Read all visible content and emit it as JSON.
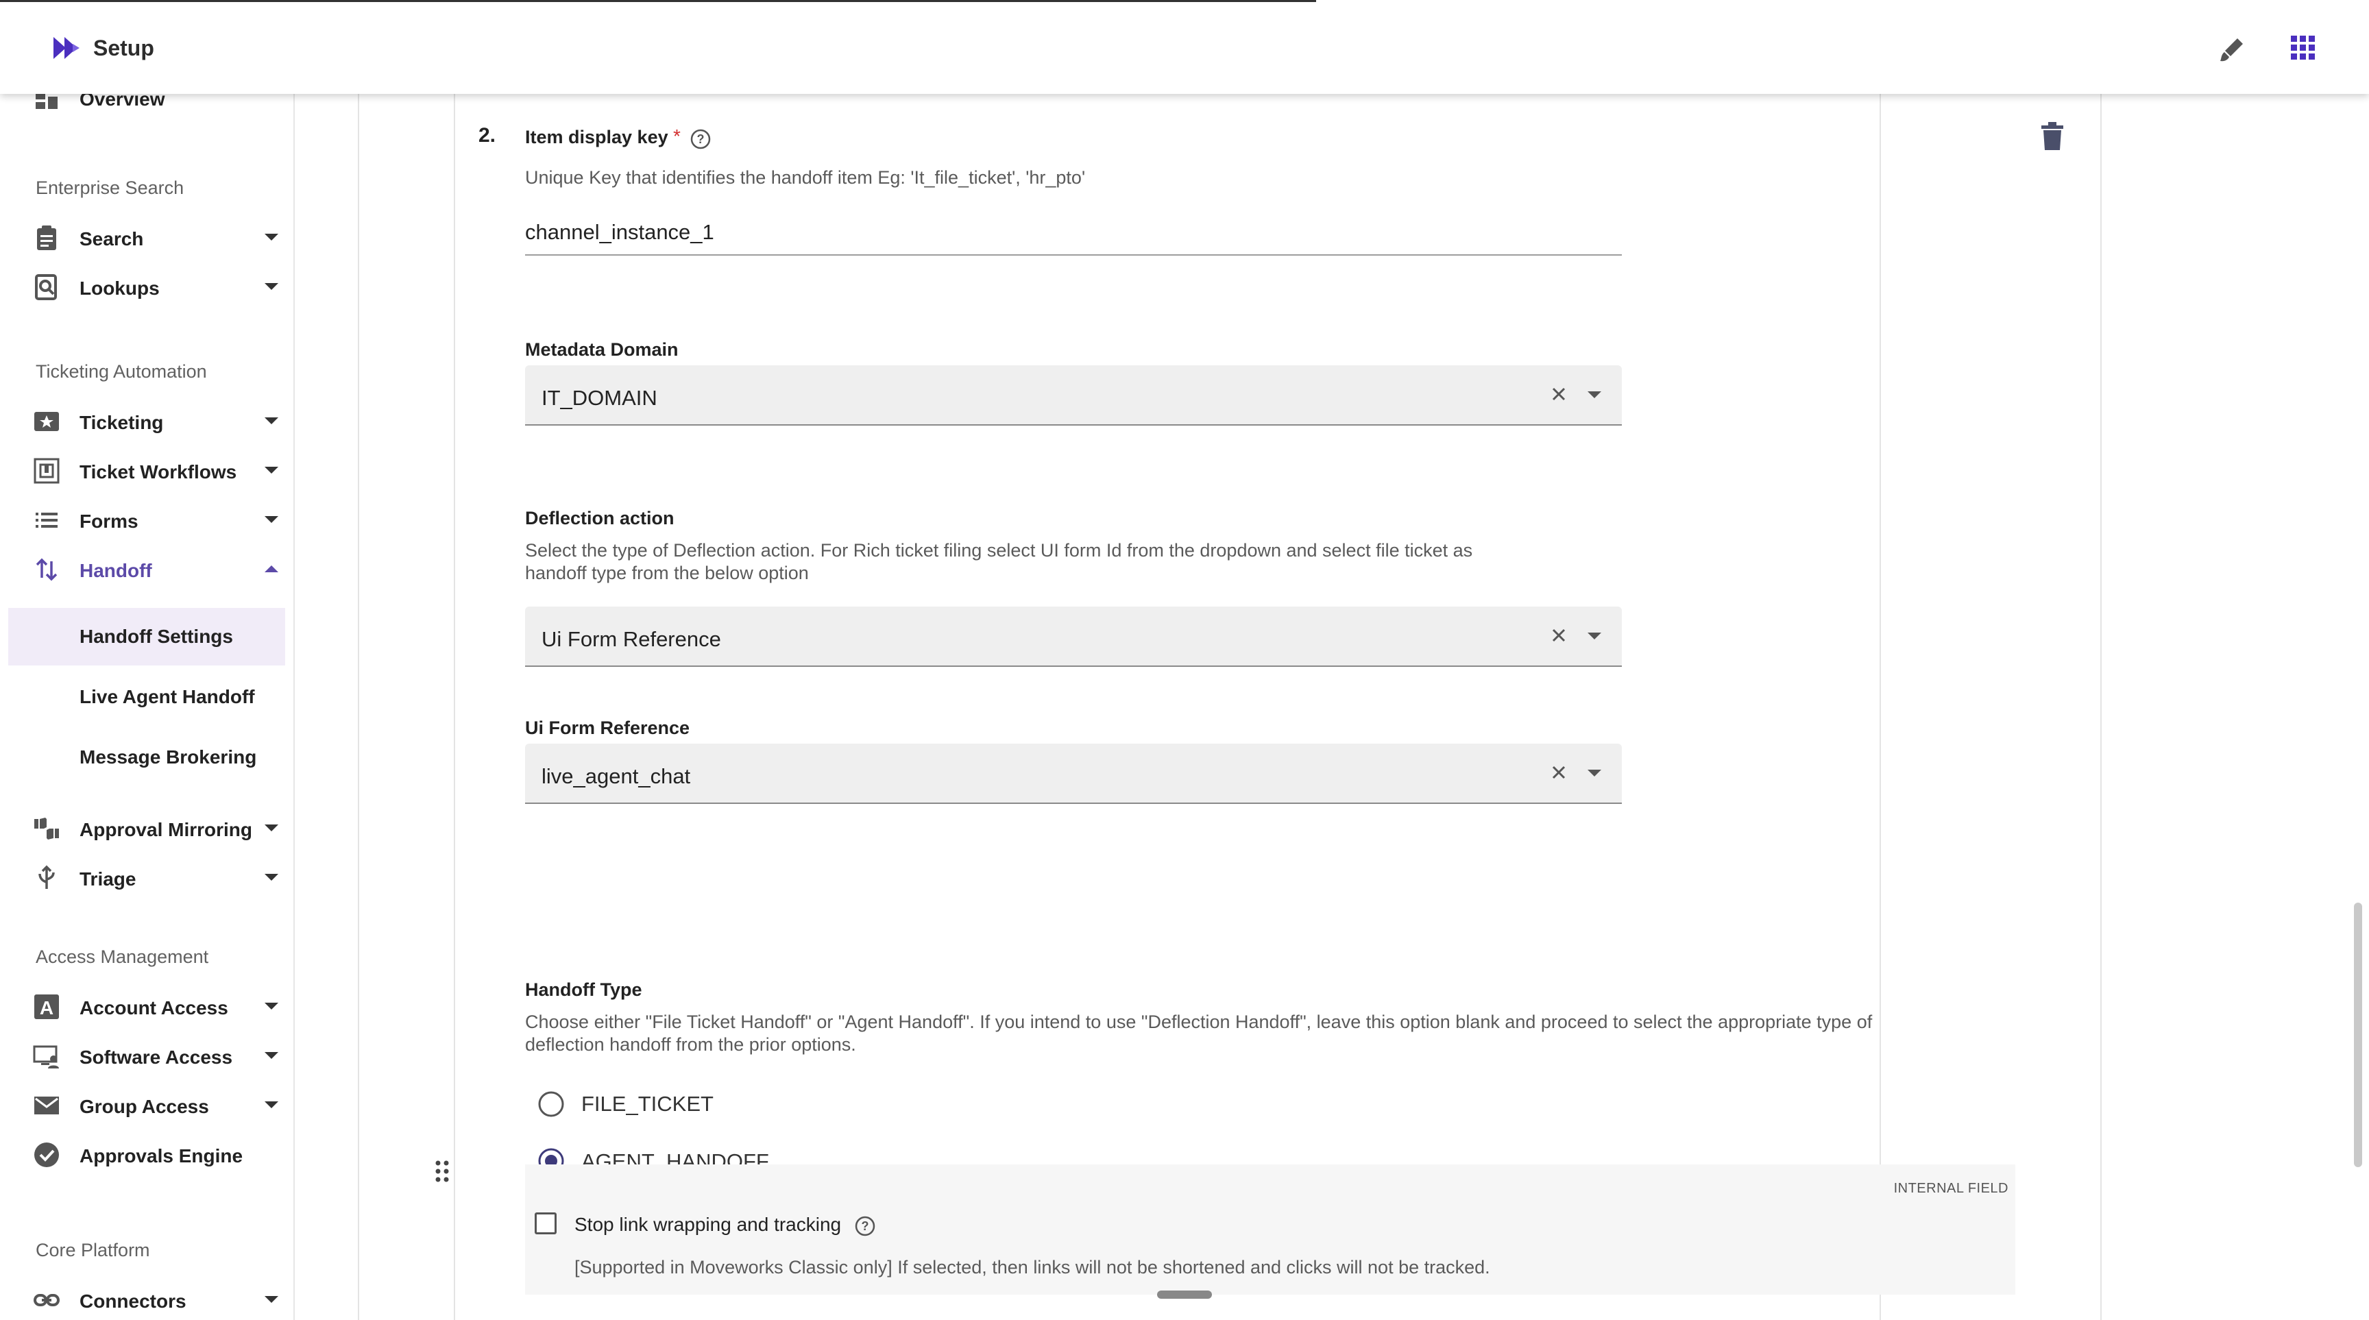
{
  "header": {
    "title": "Setup"
  },
  "sidebar": {
    "overview": "Overview",
    "sections": [
      {
        "label": "Enterprise Search"
      },
      {
        "label": "Ticketing Automation"
      },
      {
        "label": "Access Management"
      },
      {
        "label": "Core Platform"
      }
    ],
    "items": {
      "search": "Search",
      "lookups": "Lookups",
      "ticketing": "Ticketing",
      "ticket_workflows": "Ticket Workflows",
      "forms": "Forms",
      "handoff": "Handoff",
      "handoff_settings": "Handoff Settings",
      "live_agent_handoff": "Live Agent Handoff",
      "message_brokering": "Message Brokering",
      "approval_mirroring": "Approval Mirroring",
      "triage": "Triage",
      "account_access": "Account Access",
      "software_access": "Software Access",
      "group_access": "Group Access",
      "approvals_engine": "Approvals Engine",
      "connectors": "Connectors"
    }
  },
  "form": {
    "item_number": "2.",
    "item_display_key": {
      "label": "Item display key",
      "required_mark": "*",
      "help": "Unique Key that identifies the handoff item Eg: 'It_file_ticket', 'hr_pto'",
      "value": "channel_instance_1"
    },
    "metadata_domain": {
      "label": "Metadata Domain",
      "value": "IT_DOMAIN"
    },
    "deflection_action": {
      "label": "Deflection action",
      "help_line1": "Select the type of Deflection action. For Rich ticket filing select UI form Id from the dropdown and select file ticket as",
      "help_line2": "handoff type from the below option",
      "value": "Ui Form Reference"
    },
    "ui_form_reference": {
      "label": "Ui Form Reference",
      "value": "live_agent_chat"
    },
    "handoff_type": {
      "label": "Handoff Type",
      "help_line1": "Choose either \"File Ticket Handoff\" or \"Agent Handoff\". If you intend to use \"Deflection Handoff\", leave this option blank and proceed to select the appropriate type of",
      "help_line2": "deflection handoff from the prior options.",
      "options": [
        "FILE_TICKET",
        "AGENT_HANDOFF"
      ],
      "selected": "AGENT_HANDOFF"
    },
    "internal": {
      "tag": "INTERNAL FIELD",
      "checkbox_label": "Stop link wrapping and tracking",
      "checked": false,
      "help": "[Supported in Moveworks Classic only] If selected, then links will not be shortened and clicks will not be tracked."
    }
  },
  "colors": {
    "accent": "#5c4aa8",
    "logo": "#4b2fbf"
  }
}
